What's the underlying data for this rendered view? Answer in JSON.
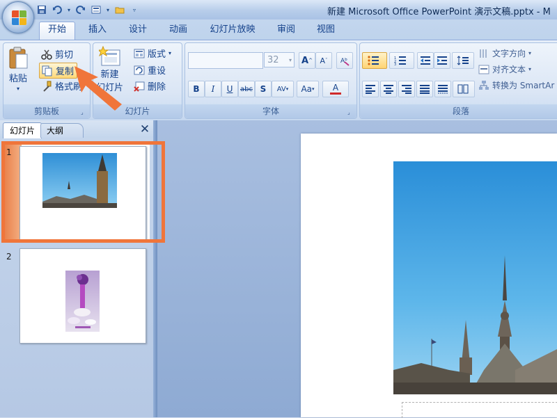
{
  "window": {
    "title": "新建 Microsoft Office PowerPoint 演示文稿.pptx - M"
  },
  "quick_access": {
    "icons": [
      "save-icon",
      "undo-icon",
      "redo-icon",
      "layout-icon",
      "folder-icon",
      "customize-icon"
    ]
  },
  "tabs": [
    {
      "label": "开始",
      "active": true
    },
    {
      "label": "插入"
    },
    {
      "label": "设计"
    },
    {
      "label": "动画"
    },
    {
      "label": "幻灯片放映"
    },
    {
      "label": "审阅"
    },
    {
      "label": "视图"
    }
  ],
  "ribbon": {
    "clipboard": {
      "label": "剪贴板",
      "paste": "粘贴",
      "cut": "剪切",
      "copy": "复制",
      "format_painter": "格式刷"
    },
    "slides": {
      "label": "幻灯片",
      "new_slide_top": "新建",
      "new_slide_bottom": "幻灯片",
      "layout": "版式",
      "reset": "重设",
      "delete": "删除"
    },
    "font": {
      "label": "字体",
      "font_name": "",
      "font_size": "32",
      "buttons": [
        "A",
        "A",
        "B",
        "I",
        "U",
        "abc",
        "S",
        "AV",
        "Aa",
        "A"
      ]
    },
    "paragraph": {
      "label": "段落",
      "text_direction": "文字方向",
      "align_text": "对齐文本",
      "convert_smartart": "转换为 SmartAr"
    }
  },
  "panel": {
    "tab_slides": "幻灯片",
    "tab_outline": "大纲",
    "close_glyph": "✕"
  },
  "slides": [
    {
      "number": "1",
      "image": "city-towers-photo",
      "selected": true
    },
    {
      "number": "2",
      "image": "purple-flower-vase-photo",
      "selected": false
    }
  ],
  "annotation": {
    "highlight_color": "#f0753a",
    "arrow_color": "#f0753a"
  }
}
